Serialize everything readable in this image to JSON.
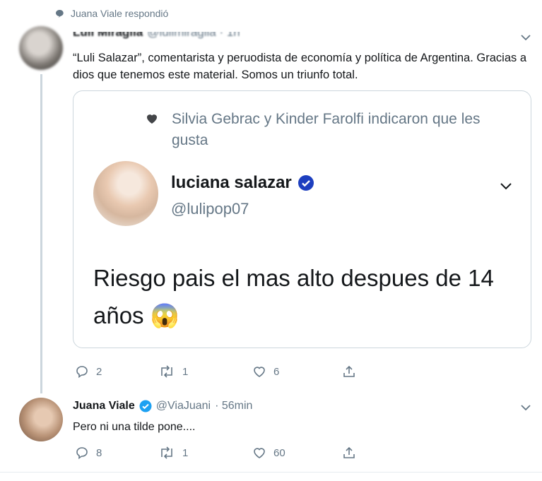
{
  "context": {
    "text": "Juana Viale respondió",
    "icon": "speech-bubble-icon"
  },
  "tweet1": {
    "name": "Luli Miraglia",
    "handle": "@lulimiraglia · 1h",
    "text": "“Luli Salazar”, comentarista y peruodista de economía y política de Argentina. Gracias a dios que tenemos este material. Somos un triunfo total.",
    "quote": {
      "liked_by": "Silvia Gebrac y Kinder Farolfi indicaron que les gusta",
      "name": "luciana salazar",
      "handle": "@lulipop07",
      "text": "Riesgo pais el mas alto despues de 14 años",
      "emoji": "😱"
    },
    "actions": {
      "replies": "2",
      "retweets": "1",
      "likes": "6"
    }
  },
  "tweet2": {
    "name": "Juana Viale",
    "handle": "@ViaJuani",
    "time": "· 56min",
    "text": "Pero ni una tilde pone....",
    "actions": {
      "replies": "8",
      "retweets": "1",
      "likes": "60"
    }
  },
  "colors": {
    "muted": "#657786",
    "verified": "#1da1f2",
    "border": "#ccd6dd"
  }
}
